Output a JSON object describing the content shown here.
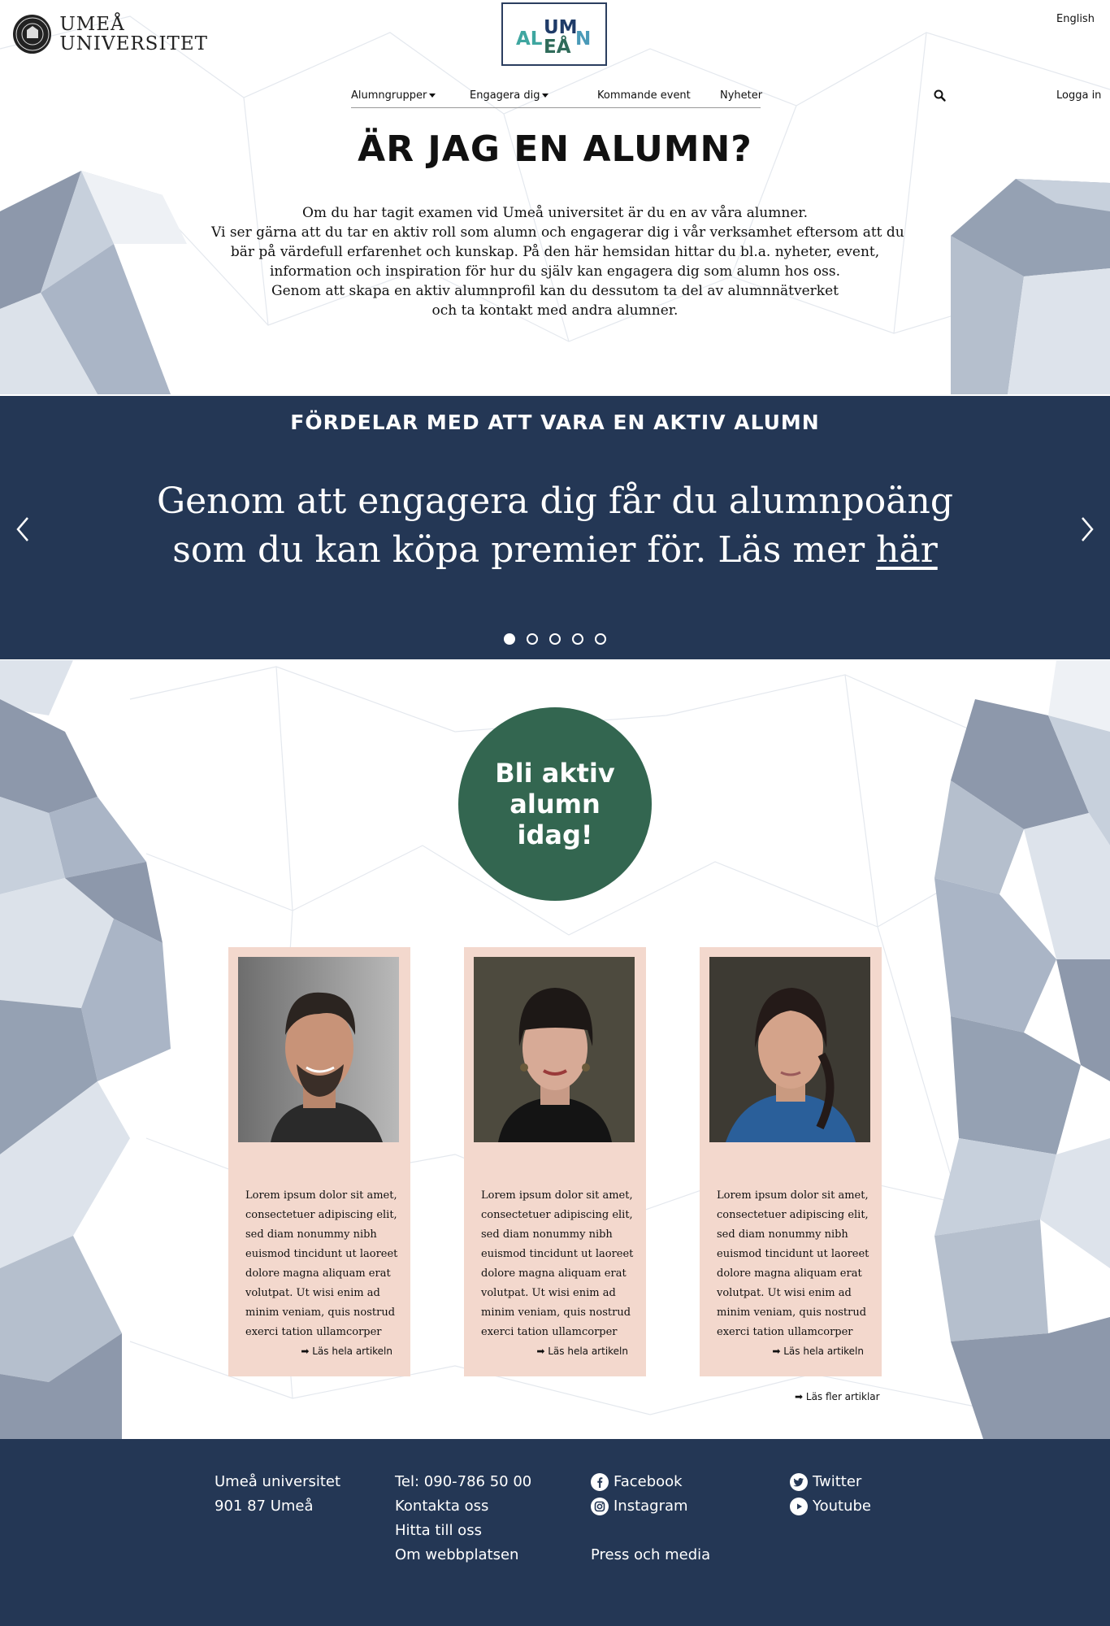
{
  "header": {
    "university_name_line1": "UMEÅ",
    "university_name_line2": "UNIVERSITET",
    "alumn_logo_text": [
      "AL",
      "UM",
      "EÅ",
      "N"
    ],
    "language_link": "English",
    "login_link": "Logga in",
    "nav": [
      {
        "label": "Alumngrupper",
        "has_dropdown": true
      },
      {
        "label": "Engagera dig",
        "has_dropdown": true
      },
      {
        "label": "Kommande event",
        "has_dropdown": false
      },
      {
        "label": "Nyheter",
        "has_dropdown": false
      }
    ]
  },
  "intro": {
    "title": "ÄR JAG EN ALUMN?",
    "lines": [
      "Om du har tagit examen vid Umeå universitet är du en av våra alumner.",
      "Vi ser gärna att du tar en aktiv roll som alumn och engagerar dig i vår verksamhet eftersom att du",
      "bär på värdefull erfarenhet och kunskap. På den här hemsidan hittar du bl.a. nyheter, event,",
      "information och inspiration för hur du själv kan engagera dig som alumn hos oss.",
      "Genom att skapa en aktiv alumnprofil kan du dessutom ta del av alumnnätverket",
      "och ta kontakt med andra alumner."
    ]
  },
  "carousel": {
    "heading": "FÖRDELAR MED ATT VARA EN AKTIV ALUMN",
    "line1": "Genom att engagera dig får du alumnpoäng",
    "line2_text": "som du kan köpa premier för. Läs mer ",
    "line2_link": "här",
    "slide_count": 5,
    "active_slide": 1
  },
  "cta": {
    "label": "Bli aktiv alumn idag!",
    "color": "#336650"
  },
  "articles": [
    {
      "text": "Lorem ipsum dolor sit amet, consectetuer adipiscing elit, sed diam nonummy nibh euismod tincidunt ut laoreet dolore magna aliquam erat volutpat. Ut wisi enim ad minim veniam, quis nostrud exerci tation ullamcorper",
      "link": "Läs hela artikeln"
    },
    {
      "text": "Lorem ipsum dolor sit amet, consectetuer adipiscing elit, sed diam nonummy nibh euismod tincidunt ut laoreet dolore magna aliquam erat volutpat. Ut wisi enim ad minim veniam, quis nostrud exerci tation ullamcorper",
      "link": "Läs hela artikeln"
    },
    {
      "text": "Lorem ipsum dolor sit amet, consectetuer adipiscing elit, sed diam nonummy nibh euismod tincidunt ut laoreet dolore magna aliquam erat volutpat. Ut wisi enim ad minim veniam, quis nostrud exerci tation ullamcorper",
      "link": "Läs hela artikeln"
    }
  ],
  "more_articles": "Läs fler artiklar",
  "footer": {
    "address": [
      "Umeå universitet",
      "901 87 Umeå"
    ],
    "contact": [
      "Tel: 090-786 50 00",
      "Kontakta oss",
      "Hitta till oss",
      "Om webbplatsen"
    ],
    "social_left": [
      {
        "label": "Facebook",
        "icon": "facebook-icon"
      },
      {
        "label": "Instagram",
        "icon": "instagram-icon"
      }
    ],
    "press": "Press och media",
    "social_right": [
      {
        "label": "Twitter",
        "icon": "twitter-icon"
      },
      {
        "label": "Youtube",
        "icon": "youtube-icon"
      }
    ]
  },
  "colors": {
    "navy": "#243755",
    "green": "#336650",
    "card_bg": "#f3d8cd"
  }
}
